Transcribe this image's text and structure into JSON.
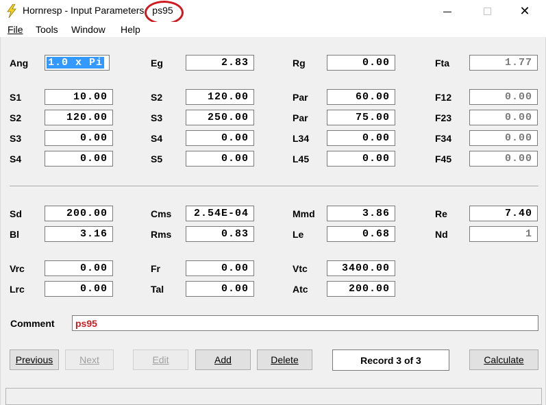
{
  "window": {
    "title_prefix": "Hornresp - Input Parameters",
    "title_file": "ps95",
    "minimize_glyph": "minimize",
    "maximize_glyph": "maximize",
    "close_glyph": "✕"
  },
  "menu": {
    "file": "File",
    "tools": "Tools",
    "window": "Window",
    "help": "Help"
  },
  "params": {
    "ang": {
      "label": "Ang",
      "value": "1.0 x Pi"
    },
    "eg": {
      "label": "Eg",
      "value": "2.83"
    },
    "rg": {
      "label": "Rg",
      "value": "0.00"
    },
    "fta": {
      "label": "Fta",
      "value": "1.77"
    },
    "r1": {
      "l1": "S1",
      "v1": "10.00",
      "l2": "S2",
      "v2": "120.00",
      "l3": "Par",
      "v3": "60.00",
      "l4": "F12",
      "v4": "0.00"
    },
    "r2": {
      "l1": "S2",
      "v1": "120.00",
      "l2": "S3",
      "v2": "250.00",
      "l3": "Par",
      "v3": "75.00",
      "l4": "F23",
      "v4": "0.00"
    },
    "r3": {
      "l1": "S3",
      "v1": "0.00",
      "l2": "S4",
      "v2": "0.00",
      "l3": "L34",
      "v3": "0.00",
      "l4": "F34",
      "v4": "0.00"
    },
    "r4": {
      "l1": "S4",
      "v1": "0.00",
      "l2": "S5",
      "v2": "0.00",
      "l3": "L45",
      "v3": "0.00",
      "l4": "F45",
      "v4": "0.00"
    },
    "d1": {
      "l1": "Sd",
      "v1": "200.00",
      "l2": "Cms",
      "v2": "2.54E-04",
      "l3": "Mmd",
      "v3": "3.86",
      "l4": "Re",
      "v4": "7.40"
    },
    "d2": {
      "l1": "Bl",
      "v1": "3.16",
      "l2": "Rms",
      "v2": "0.83",
      "l3": "Le",
      "v3": "0.68",
      "l4": "Nd",
      "v4": "1"
    },
    "c1": {
      "l1": "Vrc",
      "v1": "0.00",
      "l2": "Fr",
      "v2": "0.00",
      "l3": "Vtc",
      "v3": "3400.00"
    },
    "c2": {
      "l1": "Lrc",
      "v1": "0.00",
      "l2": "Tal",
      "v2": "0.00",
      "l3": "Atc",
      "v3": "200.00"
    }
  },
  "comment": {
    "label": "Comment",
    "value": "ps95"
  },
  "buttons": {
    "previous": "Previous",
    "next": "Next",
    "edit": "Edit",
    "add": "Add",
    "delete": "Delete",
    "record": "Record 3 of 3",
    "calculate": "Calculate"
  },
  "colors": {
    "highlight": "#d0191f",
    "selection": "#3399ff",
    "icon": "#f5d21d"
  }
}
